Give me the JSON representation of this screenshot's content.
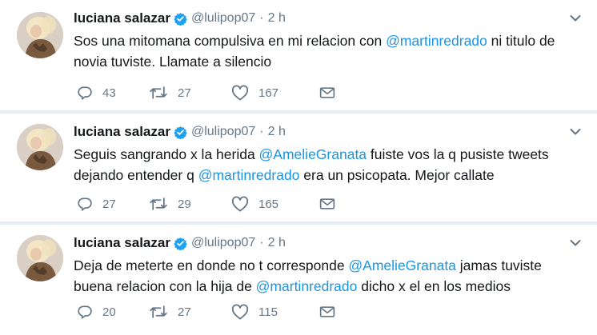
{
  "tweets": [
    {
      "user": {
        "name": "luciana salazar",
        "handle": "@lulipop07",
        "separator": "·",
        "time": "2 h"
      },
      "text": [
        {
          "t": "Sos una mitomana compulsiva en mi relacion con "
        },
        {
          "t": "@martinredrado",
          "mention": true
        },
        {
          "t": "  ni titulo de novia tuviste. Llamate a silencio"
        }
      ],
      "replies": "43",
      "retweets": "27",
      "likes": "167"
    },
    {
      "user": {
        "name": "luciana salazar",
        "handle": "@lulipop07",
        "separator": "·",
        "time": "2 h"
      },
      "text": [
        {
          "t": "Seguis sangrando x la herida "
        },
        {
          "t": "@AmelieGranata",
          "mention": true
        },
        {
          "t": " fuiste vos la q pusiste tweets dejando entender q "
        },
        {
          "t": "@martinredrado",
          "mention": true
        },
        {
          "t": " era un psicopata. Mejor callate"
        }
      ],
      "replies": "27",
      "retweets": "29",
      "likes": "165"
    },
    {
      "user": {
        "name": "luciana salazar",
        "handle": "@lulipop07",
        "separator": "·",
        "time": "2 h"
      },
      "text": [
        {
          "t": "Deja de meterte en donde no t corresponde "
        },
        {
          "t": "@AmelieGranata",
          "mention": true
        },
        {
          "t": " jamas tuviste buena relacion con la hija de "
        },
        {
          "t": "@martinredrado",
          "mention": true
        },
        {
          "t": " dicho x el en los medios"
        }
      ],
      "replies": "20",
      "retweets": "27",
      "likes": "115"
    }
  ],
  "icons": {
    "verified": "verified-badge-icon",
    "caret": "chevron-down-icon",
    "reply": "reply-icon",
    "retweet": "retweet-icon",
    "like": "heart-icon",
    "dm": "envelope-icon"
  },
  "colors": {
    "mention": "#1b95e0",
    "verified": "#1da1f2",
    "secondary_text": "#657786",
    "separator_background": "#e6ecf0"
  }
}
